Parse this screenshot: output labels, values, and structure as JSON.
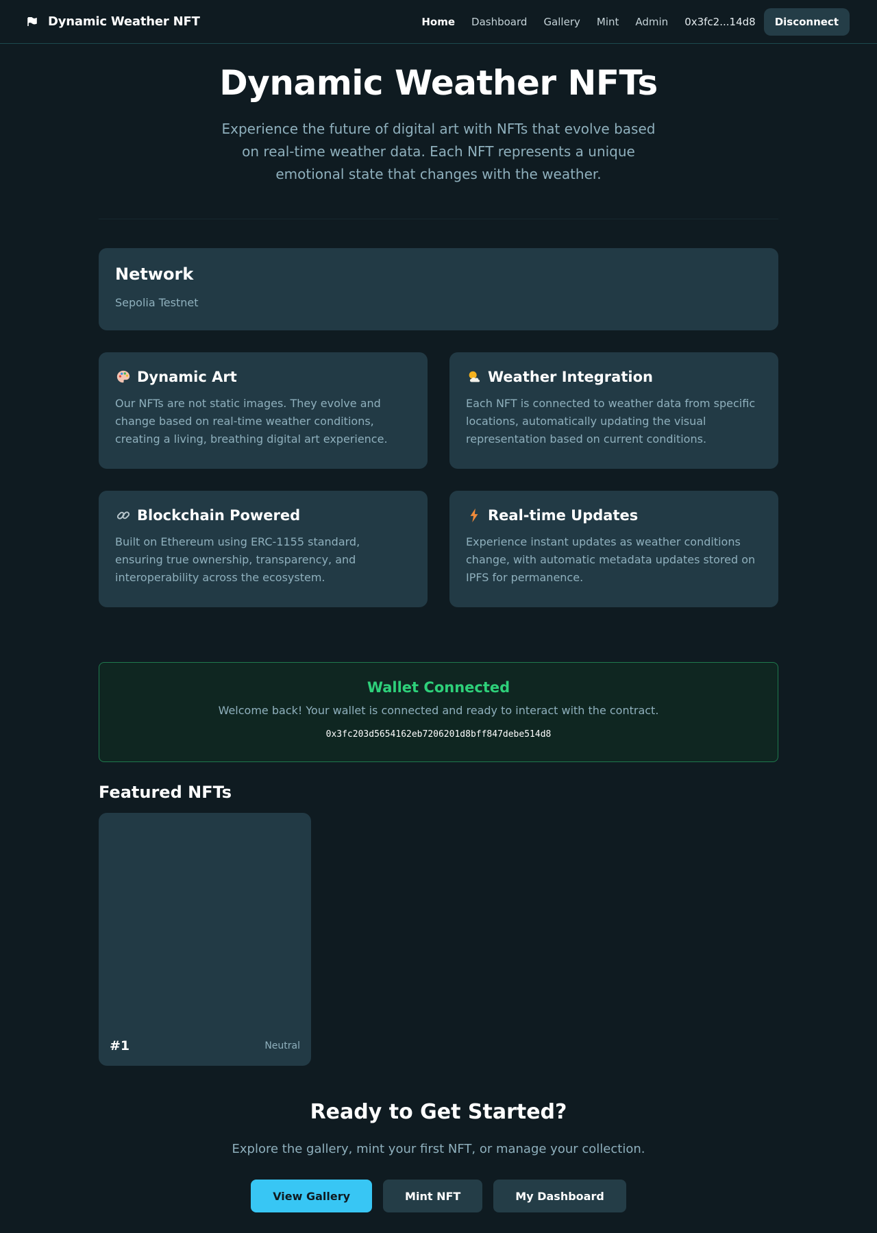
{
  "nav": {
    "brand": "Dynamic Weather NFT",
    "brand_icon": "flag-icon",
    "links": [
      "Home",
      "Dashboard",
      "Gallery",
      "Mint",
      "Admin"
    ],
    "active": "Home",
    "address": "0x3fc2...14d8",
    "disconnect_label": "Disconnect"
  },
  "hero": {
    "title": "Dynamic Weather NFTs",
    "subtitle": "Experience the future of digital art with NFTs that evolve based on real-time weather data. Each NFT represents a unique emotional state that changes with the weather."
  },
  "network": {
    "title": "Network",
    "value": "Sepolia Testnet"
  },
  "features": [
    {
      "icon": "palette-icon",
      "title": "Dynamic Art",
      "description": "Our NFTs are not static images. They evolve and change based on real-time weather conditions, creating a living, breathing digital art experience."
    },
    {
      "icon": "sun-cloud-icon",
      "title": "Weather Integration",
      "description": "Each NFT is connected to weather data from specific locations, automatically updating the visual representation based on current conditions."
    },
    {
      "icon": "link-icon",
      "title": "Blockchain Powered",
      "description": "Built on Ethereum using ERC-1155 standard, ensuring true ownership, transparency, and interoperability across the ecosystem."
    },
    {
      "icon": "lightning-icon",
      "title": "Real-time Updates",
      "description": "Experience instant updates as weather conditions change, with automatic metadata updates stored on IPFS for permanence."
    }
  ],
  "wallet": {
    "title": "Wallet Connected",
    "message": "Welcome back! Your wallet is connected and ready to interact with the contract.",
    "address": "0x3fc203d5654162eb7206201d8bff847debe514d8"
  },
  "featured": {
    "heading": "Featured NFTs",
    "items": [
      {
        "id": "#1",
        "mood": "Neutral"
      }
    ]
  },
  "cta": {
    "heading": "Ready to Get Started?",
    "text": "Explore the gallery, mint your first NFT, or manage your collection.",
    "buttons": [
      "View Gallery",
      "Mint NFT",
      "My Dashboard"
    ]
  },
  "colors": {
    "background": "#0f1b21",
    "card": "#223a45",
    "accent": "#38c6f4",
    "success": "#2ed07a",
    "muted_text": "#8fb0bd"
  }
}
